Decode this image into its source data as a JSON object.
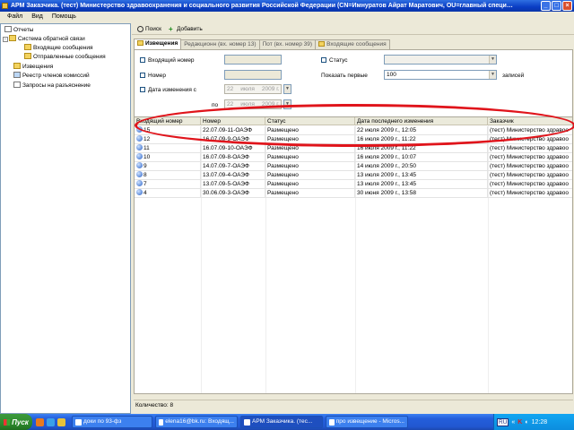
{
  "window": {
    "title": "АРМ Заказчика. (тест) Министерство здравоохранения и социального развития Российской Федерации (CN=Имнуратов Айрат Маратович, OU=главный специал..."
  },
  "menu": [
    "Файл",
    "Вид",
    "Помощь"
  ],
  "tree": [
    {
      "label": "Отчеты",
      "icon": "report-icon",
      "level": 0,
      "toggle": ""
    },
    {
      "label": "Система обратной связи",
      "icon": "folder-icon",
      "level": 0,
      "toggle": "-"
    },
    {
      "label": "Входящие сообщения",
      "icon": "folder-icon",
      "level": 1,
      "toggle": ""
    },
    {
      "label": "Отправленные сообщения",
      "icon": "folder-icon",
      "level": 1,
      "toggle": ""
    },
    {
      "label": "Извещения",
      "icon": "folder-icon",
      "level": 0,
      "toggle": ""
    },
    {
      "label": "Реестр членов комиссий",
      "icon": "registry-icon",
      "level": 0,
      "toggle": ""
    },
    {
      "label": "Запросы на разъяснение",
      "icon": "document-icon",
      "level": 0,
      "toggle": ""
    }
  ],
  "toolbar": {
    "search": "Поиск",
    "add": "Добавить"
  },
  "tabs": [
    {
      "label": "Извещения",
      "active": true
    },
    {
      "label": "Редакционн (вх. номер 13)",
      "active": false
    },
    {
      "label": "Пот (вх. номер 39)",
      "active": false
    },
    {
      "label": "Входящие сообщения",
      "active": false
    }
  ],
  "filter": {
    "incoming_number": "Входящий номер",
    "number": "Номер",
    "date_changed_from": "Дата изменения с",
    "to": "по",
    "status": "Статус",
    "show_first": "Показать первые",
    "show_first_value": "100",
    "records": "записей",
    "date_from": {
      "day": "22",
      "month": "июля",
      "year": "2009 г."
    },
    "date_to": {
      "day": "22",
      "month": "июля",
      "year": "2009 г."
    }
  },
  "grid": {
    "columns": [
      "Входящий номер",
      "Номер",
      "Статус",
      "Дата последнего изменения",
      "Заказчик"
    ],
    "rows": [
      {
        "in": "15",
        "num": "22.07.09-11-ОАЭФ",
        "status": "Размещено",
        "date": "22 июля 2009 г., 12:05",
        "customer": "(тест) Министерство здравоо"
      },
      {
        "in": "12",
        "num": "16.07.09-9-ОАЭФ",
        "status": "Размещено",
        "date": "16 июля 2009 г., 11:22",
        "customer": "(тест) Министерство здравоо"
      },
      {
        "in": "11",
        "num": "16.07.09-10-ОАЭФ",
        "status": "Размещено",
        "date": "16 июля 2009 г., 11:22",
        "customer": "(тест) Министерство здравоо"
      },
      {
        "in": "10",
        "num": "16.07.09-8-ОАЭФ",
        "status": "Размещено",
        "date": "16 июля 2009 г., 10:07",
        "customer": "(тест) Министерство здравоо"
      },
      {
        "in": "9",
        "num": "14.07.09-7-ОАЭФ",
        "status": "Размещено",
        "date": "14 июля 2009 г., 20:50",
        "customer": "(тест) Министерство здравоо"
      },
      {
        "in": "8",
        "num": "13.07.09-4-ОАЭФ",
        "status": "Размещено",
        "date": "13 июля 2009 г., 13:45",
        "customer": "(тест) Министерство здравоо"
      },
      {
        "in": "7",
        "num": "13.07.09-5-ОАЭФ",
        "status": "Размещено",
        "date": "13 июля 2009 г., 13:45",
        "customer": "(тест) Министерство здравоо"
      },
      {
        "in": "4",
        "num": "30.06.09-3-ОАЭФ",
        "status": "Размещено",
        "date": "30 июня 2009 г., 13:58",
        "customer": "(тест) Министерство здравоо"
      }
    ]
  },
  "status": {
    "count": "Количество: 8"
  },
  "taskbar": {
    "start": "Пуск",
    "tasks": [
      {
        "label": "доки по 93-фз",
        "active": false
      },
      {
        "label": "elena16@bk.ru: Входящ...",
        "active": false
      },
      {
        "label": "АРМ Заказчика. (тес...",
        "active": true
      },
      {
        "label": "про извещение - Micros...",
        "active": false
      }
    ],
    "lang": "RU",
    "clock": "12:28"
  },
  "colors": {
    "annotation": "#e0141b",
    "title_bar": "#0a3dc4",
    "taskbar": "#245edb"
  }
}
